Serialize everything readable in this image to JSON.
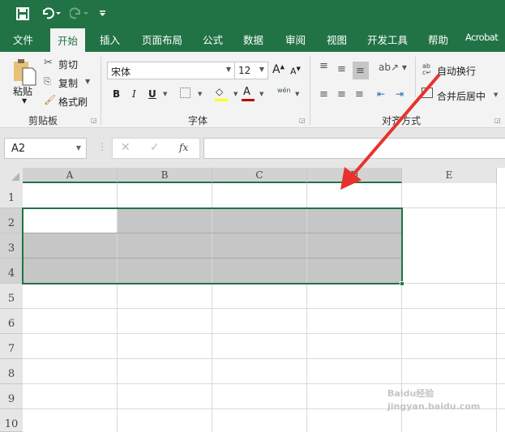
{
  "qat": {
    "icons": [
      "save-icon",
      "undo-icon",
      "redo-icon",
      "customize-icon"
    ]
  },
  "tabs": [
    "文件",
    "开始",
    "插入",
    "页面布局",
    "公式",
    "数据",
    "审阅",
    "视图",
    "开发工具",
    "帮助",
    "Acrobat"
  ],
  "active_tab": "开始",
  "ribbon": {
    "clipboard": {
      "paste": "粘贴",
      "cut": "剪切",
      "copy": "复制",
      "format_painter": "格式刷",
      "label": "剪贴板"
    },
    "font": {
      "name": "宋体",
      "size": "12",
      "bold": "B",
      "italic": "I",
      "underline": "U",
      "phonetic": "wén",
      "label": "字体",
      "fill_color": "#ffff00",
      "font_color": "#c00000"
    },
    "alignment": {
      "wrap_text": "自动换行",
      "merge_center": "合并后居中",
      "label": "对齐方式"
    }
  },
  "formula_bar": {
    "name_box": "A2",
    "fx": "fx",
    "value": ""
  },
  "sheet": {
    "columns": [
      "A",
      "B",
      "C",
      "D",
      "E"
    ],
    "rows": [
      "1",
      "2",
      "3",
      "4",
      "5",
      "6",
      "7",
      "8",
      "9",
      "10"
    ],
    "selection": "A2:D4",
    "active_cell": "A2",
    "accent": "#217346"
  },
  "annotation": {
    "arrow_color": "#e8322d"
  },
  "watermark": "Baidu经验 jingyan.baidu.com"
}
